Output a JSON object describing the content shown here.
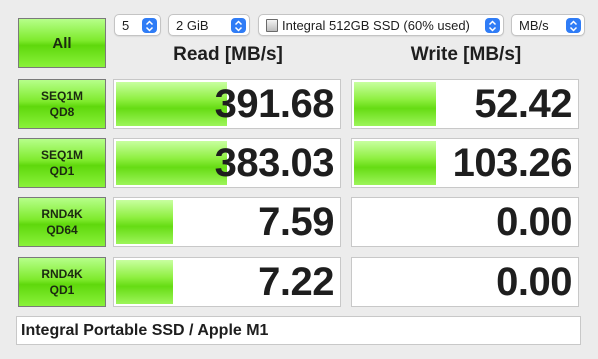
{
  "toolbar": {
    "all_label": "All",
    "count_value": "5",
    "size_value": "2 GiB",
    "drive_value": "Integral 512GB SSD (60% used)",
    "unit_value": "MB/s"
  },
  "columns": {
    "read_label": "Read [MB/s]",
    "write_label": "Write [MB/s]"
  },
  "tests": [
    {
      "line1": "SEQ1M",
      "line2": "QD8",
      "read": "391.68",
      "write": "52.42",
      "read_fill": 0.51,
      "write_fill": 0.38
    },
    {
      "line1": "SEQ1M",
      "line2": "QD1",
      "read": "383.03",
      "write": "103.26",
      "read_fill": 0.51,
      "write_fill": 0.38
    },
    {
      "line1": "RND4K",
      "line2": "QD64",
      "read": "7.59",
      "write": "0.00",
      "read_fill": 0.27,
      "write_fill": 0.0
    },
    {
      "line1": "RND4K",
      "line2": "QD1",
      "read": "7.22",
      "write": "0.00",
      "read_fill": 0.27,
      "write_fill": 0.0
    }
  ],
  "comment": "Integral Portable SSD / Apple M1",
  "colors": {
    "accent": "#2f7cf6",
    "bar_green": "#66dc14",
    "window_bg": "#ececec"
  }
}
